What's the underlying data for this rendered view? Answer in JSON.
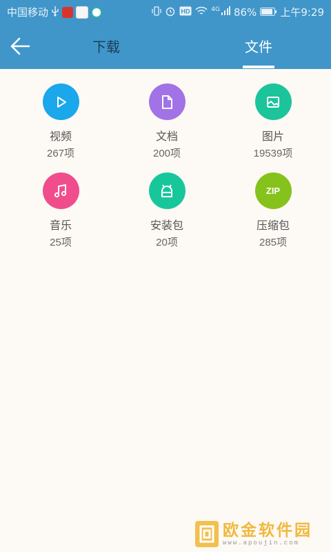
{
  "status_bar": {
    "carrier": "中国移动",
    "battery": "86%",
    "time": "上午9:29",
    "network": "4G"
  },
  "toolbar": {
    "tabs": [
      {
        "label": "下载",
        "active": false
      },
      {
        "label": "文件",
        "active": true
      }
    ]
  },
  "categories": [
    {
      "label": "视频",
      "count": "267项",
      "icon": "play-icon",
      "color": "#1aa7ec"
    },
    {
      "label": "文档",
      "count": "200项",
      "icon": "document-icon",
      "color": "#a173e6"
    },
    {
      "label": "图片",
      "count": "19539项",
      "icon": "image-icon",
      "color": "#1cc49b"
    },
    {
      "label": "音乐",
      "count": "25项",
      "icon": "music-icon",
      "color": "#f04d8c"
    },
    {
      "label": "安装包",
      "count": "20项",
      "icon": "android-icon",
      "color": "#17c79b"
    },
    {
      "label": "压缩包",
      "count": "285项",
      "icon": "zip-icon",
      "icon_text": "ZIP",
      "color": "#86c21c"
    }
  ],
  "watermark": {
    "name": "欧金软件园",
    "url": "www.apoujin.com"
  }
}
